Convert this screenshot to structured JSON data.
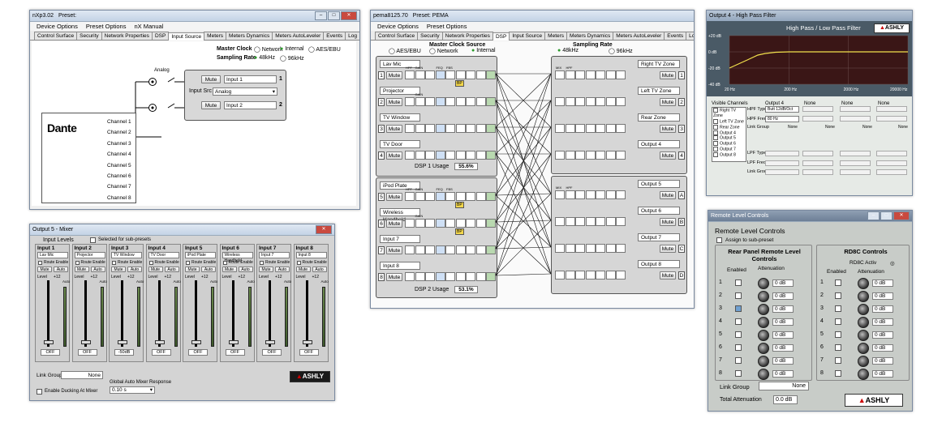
{
  "w1": {
    "title": "nXp3.02",
    "preset_label": "Preset:",
    "menu": [
      "Device Options",
      "Preset Options",
      "nX Manual"
    ],
    "tabs": [
      "Control Surface",
      "Security",
      "Network Properties",
      "DSP",
      "Input Source",
      "Meters",
      "Meters Dynamics",
      "Meters AutoLeveler",
      "Events",
      "Log"
    ],
    "active_tab": "Input Source",
    "master_clock_label": "Master Clock",
    "clock_options": [
      "Network",
      "Internal",
      "AES/EBU"
    ],
    "sampling_rate_label": "Sampling Rate",
    "rate_options": [
      "48kHz",
      "96kHz"
    ],
    "analog_label": "Analog",
    "dante_logo": "Dante",
    "channels": [
      "Channel 1",
      "Channel 2",
      "Channel 3",
      "Channel 4",
      "Channel 5",
      "Channel 6",
      "Channel 7",
      "Channel 8"
    ],
    "mute_label": "Mute",
    "input1": "Input 1",
    "input2": "Input 2",
    "input_src_label": "Input Src",
    "input_src_value": "Analog",
    "num1": "1",
    "num2": "2"
  },
  "w2": {
    "title": "pema8125.70",
    "preset_label": "Preset: PEMA",
    "menu": [
      "Device Options",
      "Preset Options"
    ],
    "tabs": [
      "Control Surface",
      "Security",
      "Network Properties",
      "DSP",
      "Input Source",
      "Meters",
      "Meters Dynamics",
      "Meters AutoLeveler",
      "Events",
      "Log"
    ],
    "active_tab": "DSP",
    "master_clock_label": "Master Clock Source",
    "clock_options": [
      "AES/EBU",
      "Network",
      "Internal"
    ],
    "sampling_rate_label": "Sampling Rate",
    "rate_options": [
      "48kHz",
      "96kHz"
    ],
    "inputs_a": [
      "Lav Mic",
      "Projector",
      "TV Window",
      "TV Door"
    ],
    "inputs_b": [
      "iPod Plate",
      "Wireless Handheld",
      "Input 7",
      "Input 8"
    ],
    "outputs_a": [
      "Right TV Zone",
      "Left TV Zone",
      "Rear Zone",
      "Output 4"
    ],
    "outputs_b": [
      "Output 5",
      "Output 6",
      "Output 7",
      "Output 8"
    ],
    "in_nums": [
      "1",
      "2",
      "3",
      "4",
      "5",
      "6",
      "7",
      "8"
    ],
    "out_nums": [
      "1",
      "2",
      "3",
      "4",
      "5",
      "6",
      "7",
      "8"
    ],
    "out_letters_b": [
      "A",
      "B",
      "C",
      "D"
    ],
    "dsp1_label": "DSP 1 Usage",
    "dsp1_value": "55.6%",
    "dsp2_label": "DSP 2 Usage",
    "dsp2_value": "53.1%",
    "mute_label": "Mute",
    "bp_label": "BP",
    "block_labels": {
      "mix": "MIX",
      "hpf": "HPF",
      "gain": "GAIN",
      "feq": "FEQ",
      "fbs": "FBS",
      "mix_out": "MIX"
    }
  },
  "w3": {
    "title": "Output 4 - High Pass Filter",
    "heading": "High Pass / Low Pass Filter",
    "y_ticks": [
      "+20 dB",
      "0 dB",
      "-20 dB",
      "-40 dB"
    ],
    "x_ticks": [
      "20 Hz",
      "200 Hz",
      "2000 Hz",
      "20000 Hz"
    ],
    "visible_channels_label": "Visible Channels",
    "visible_channels": [
      "Right TV Zone",
      "Left TV Zone",
      "Rear Zone",
      "Output 4",
      "Output 5",
      "Output 6",
      "Output 7",
      "Output 8"
    ],
    "hpf_type_label": "HPF Type",
    "hpf_freq_label": "HPF Freq",
    "link_group_label": "Link Group",
    "lpf_type_label": "LPF Type",
    "lpf_freq_label": "LPF Freq",
    "col_headers": [
      "Output 4",
      "None",
      "None",
      "None"
    ],
    "hpf_type_value": "Butt 12dB/Oct",
    "hpf_freq_value": "80 Hz",
    "link_none": "None",
    "chart_data": {
      "type": "line",
      "x_scale": "log",
      "xlim": [
        20,
        20000
      ],
      "ylim": [
        -40,
        20
      ],
      "series": [
        {
          "x": [
            20,
            40,
            60,
            80,
            120,
            200,
            20000
          ],
          "values": [
            -20,
            -10,
            -4,
            -2,
            -0.5,
            0,
            0
          ]
        }
      ]
    }
  },
  "w4": {
    "title": "Output 5 - Mixer",
    "input_levels": "Input Levels",
    "selected_for_sub": "Selected for sub-presets",
    "inputs": [
      {
        "header": "Input 1",
        "name": "Lav Mic",
        "level": "OFF"
      },
      {
        "header": "Input 2",
        "name": "Projector",
        "level": "OFF"
      },
      {
        "header": "Input 3",
        "name": "TV Window",
        "level": "-50dB"
      },
      {
        "header": "Input 4",
        "name": "TV Door",
        "level": "OFF"
      },
      {
        "header": "Input 5",
        "name": "iPod Plate",
        "level": "OFF"
      },
      {
        "header": "Input 6",
        "name": "Wireless Handheld",
        "level": "OFF"
      },
      {
        "header": "Input 7",
        "name": "Input 7",
        "level": "OFF"
      },
      {
        "header": "Input 8",
        "name": "Input 8",
        "level": "OFF"
      }
    ],
    "route_enable": "Route Enable",
    "mute": "Mute",
    "auto": "Auto",
    "level": "Level",
    "plus12": "+12",
    "link_group": "Link Group",
    "link_value": "None",
    "global_auto": "Global Auto Mixer Response",
    "global_value": "0.10 s",
    "enable_ducking": "Enable Ducking At Mixer",
    "ashly": "ASHLY"
  },
  "w5": {
    "title": "Remote Level Controls",
    "heading": "Remote Level Controls",
    "assign_sub": "Assign to sub-preset",
    "rear_heading": "Rear Panel Remote Level Controls",
    "rd8c_heading": "RD8C Controls",
    "enabled": "Enabled",
    "attenuation": "Attenuation",
    "rd8c_active": "RD8C Activ",
    "rows": [
      "1",
      "2",
      "3",
      "4",
      "5",
      "6",
      "7",
      "8"
    ],
    "att_value": "0 dB",
    "link_group": "Link Group",
    "link_value": "None",
    "total_att_label": "Total Attenuation",
    "total_att_value": "0.0 dB",
    "ashly": "ASHLY"
  }
}
